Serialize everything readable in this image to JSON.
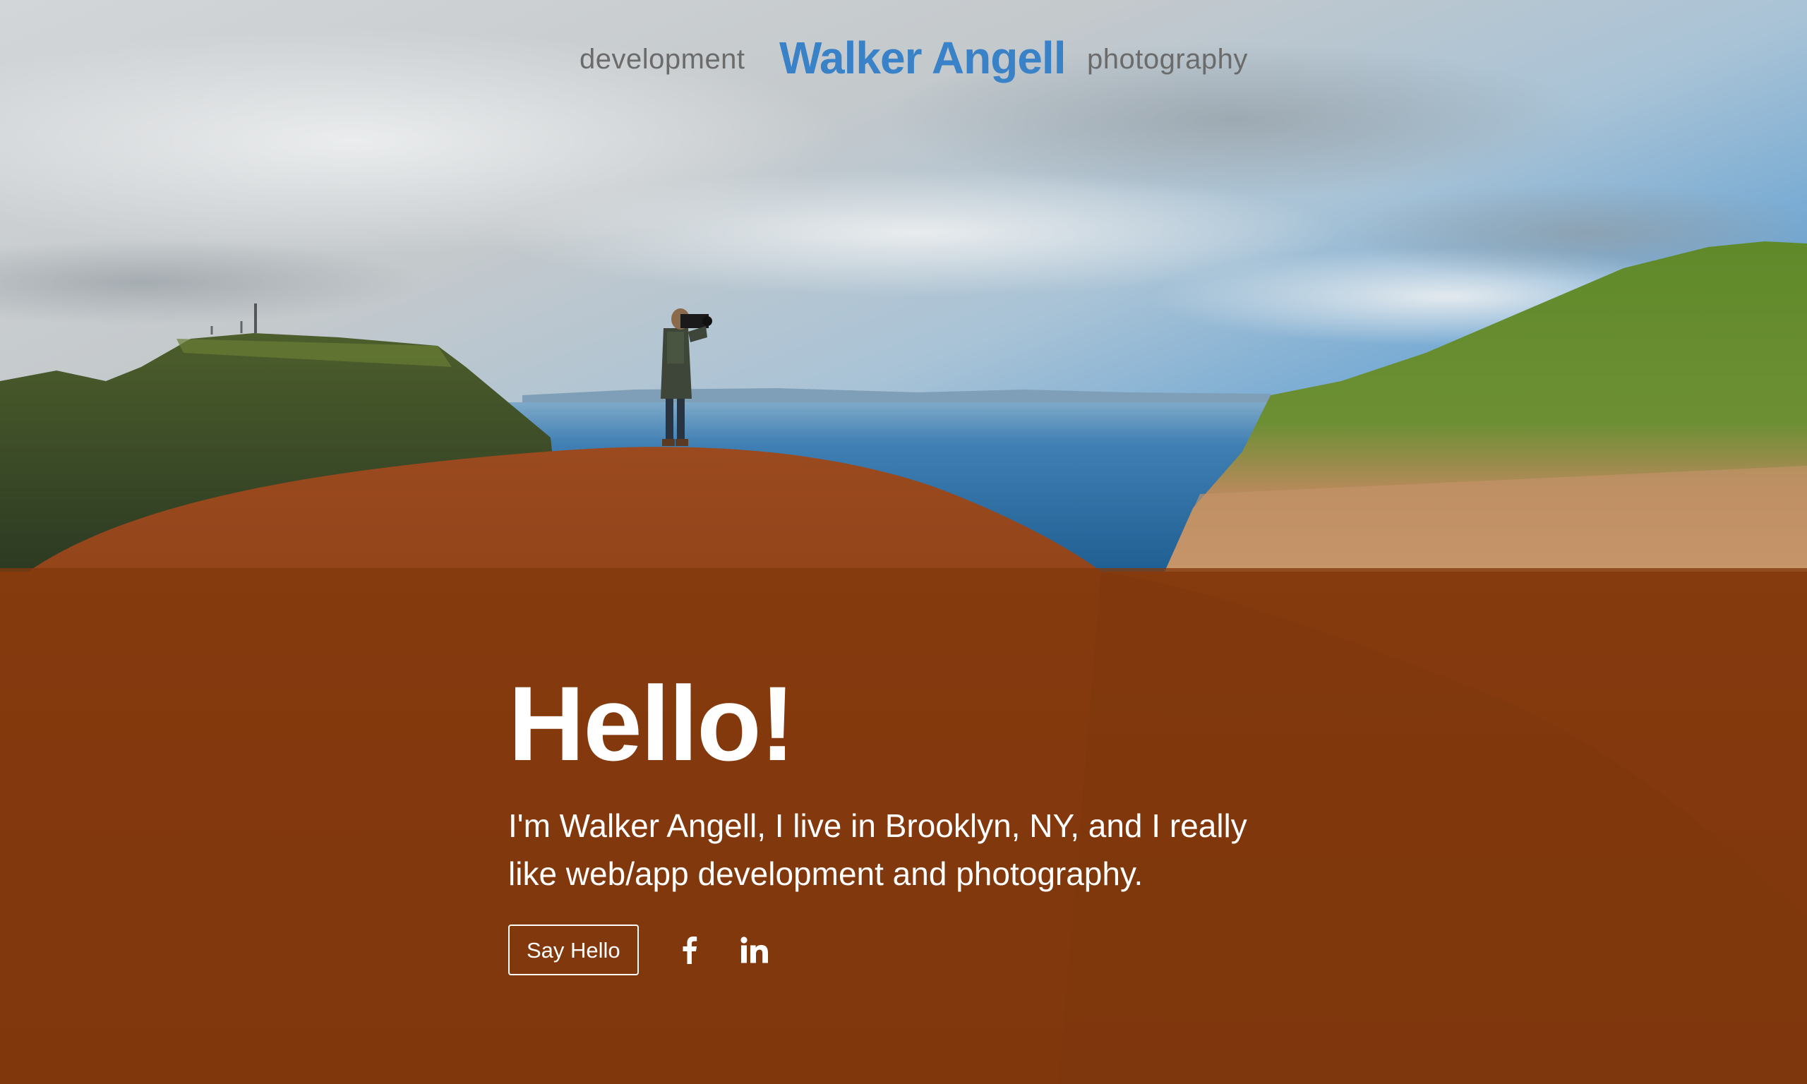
{
  "nav": {
    "left_link": "development",
    "brand": "Walker Angell",
    "right_link": "photography"
  },
  "hero": {
    "heading": "Hello!",
    "intro": "I'm Walker Angell, I live in Brooklyn, NY, and I really like web/app development and photography.",
    "cta_label": "Say Hello",
    "social_icons": [
      "facebook-icon",
      "linkedin-icon"
    ]
  },
  "colors": {
    "brand": "#3a82c8",
    "nav_text": "#6b6b6b",
    "overlay": "#82380c",
    "text_on_overlay": "#ffffff"
  }
}
